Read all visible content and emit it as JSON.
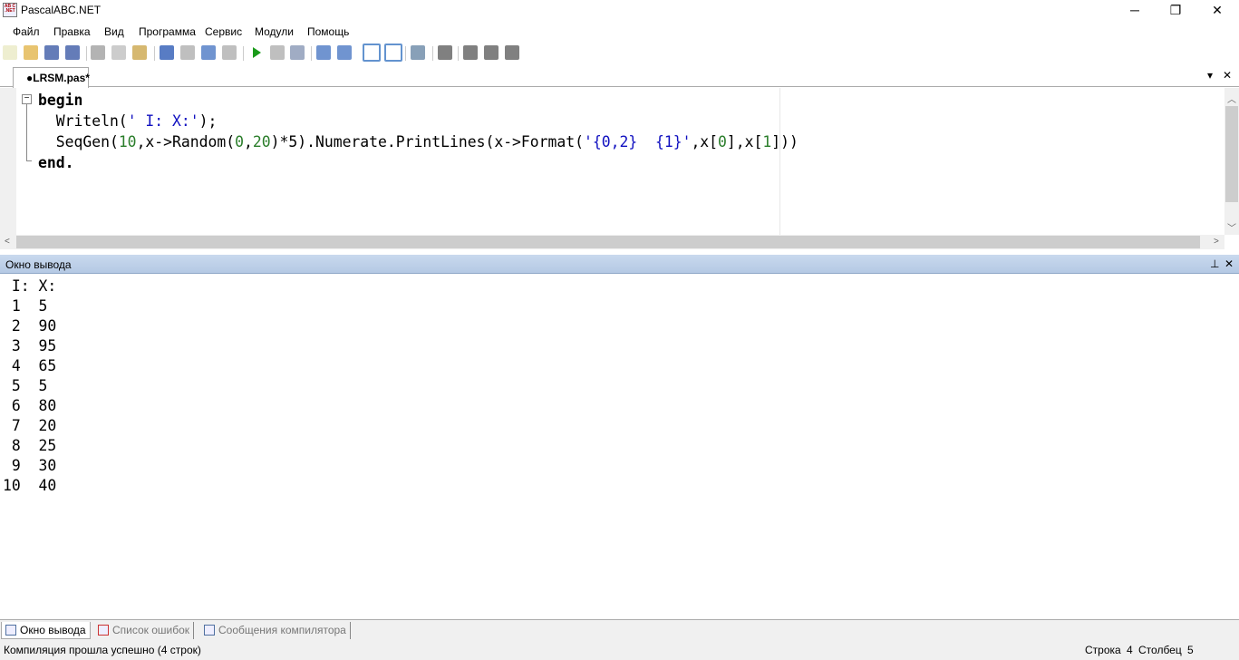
{
  "window": {
    "title": "PascalABC.NET",
    "icon_text": "AB C .NET",
    "minimize": "─",
    "maximize": "❐",
    "close": "✕"
  },
  "menu": [
    "Файл",
    "Правка",
    "Вид",
    "Программа",
    "Сервис",
    "Модули",
    "Помощь"
  ],
  "toolbar_icons": [
    "new-file-icon",
    "open-icon",
    "save-icon",
    "save-all-icon",
    "cut-icon",
    "copy-icon",
    "paste-icon",
    "undo-icon",
    "redo-icon",
    "navigate-back-icon",
    "navigate-forward-icon",
    "run-icon",
    "stop-icon",
    "debug-icon",
    "step-into-icon",
    "step-over-icon",
    "console-icon",
    "text-icon",
    "format-icon",
    "code-icon",
    "d-icon",
    "l-icon",
    "r-icon"
  ],
  "tabs": {
    "active": "●LRSM.pas*",
    "dropdown": "▾",
    "close": "✕"
  },
  "editor": {
    "lines": [
      [
        {
          "t": "begin",
          "c": "kw"
        }
      ],
      [
        {
          "t": "  Writeln(",
          "c": ""
        },
        {
          "t": "' I: X:'",
          "c": "str"
        },
        {
          "t": ");",
          "c": ""
        }
      ],
      [
        {
          "t": "  SeqGen(",
          "c": ""
        },
        {
          "t": "10",
          "c": "num"
        },
        {
          "t": ",x->Random(",
          "c": ""
        },
        {
          "t": "0",
          "c": "num"
        },
        {
          "t": ",",
          "c": ""
        },
        {
          "t": "20",
          "c": "num"
        },
        {
          "t": ")*5).Numerate.PrintLines(x->Format(",
          "c": ""
        },
        {
          "t": "'{0,2}  {1}'",
          "c": "str"
        },
        {
          "t": ",x[",
          "c": ""
        },
        {
          "t": "0",
          "c": "num"
        },
        {
          "t": "],x[",
          "c": ""
        },
        {
          "t": "1",
          "c": "num"
        },
        {
          "t": "]))",
          "c": ""
        }
      ],
      [
        {
          "t": "end.",
          "c": "kw"
        }
      ]
    ]
  },
  "output_panel": {
    "title": "Окно вывода",
    "pin": "⊥",
    "close": "✕",
    "lines": [
      " I: X:",
      " 1  5",
      " 2  90",
      " 3  95",
      " 4  65",
      " 5  5",
      " 6  80",
      " 7  20",
      " 8  25",
      " 9  30",
      "10  40"
    ]
  },
  "bottom_tabs": [
    "Окно вывода",
    "Список ошибок",
    "Сообщения компилятора"
  ],
  "status": {
    "message": "Компиляция прошла успешно (4 строк)",
    "line_label": "Строка",
    "line": "4",
    "col_label": "Столбец",
    "col": "5"
  }
}
